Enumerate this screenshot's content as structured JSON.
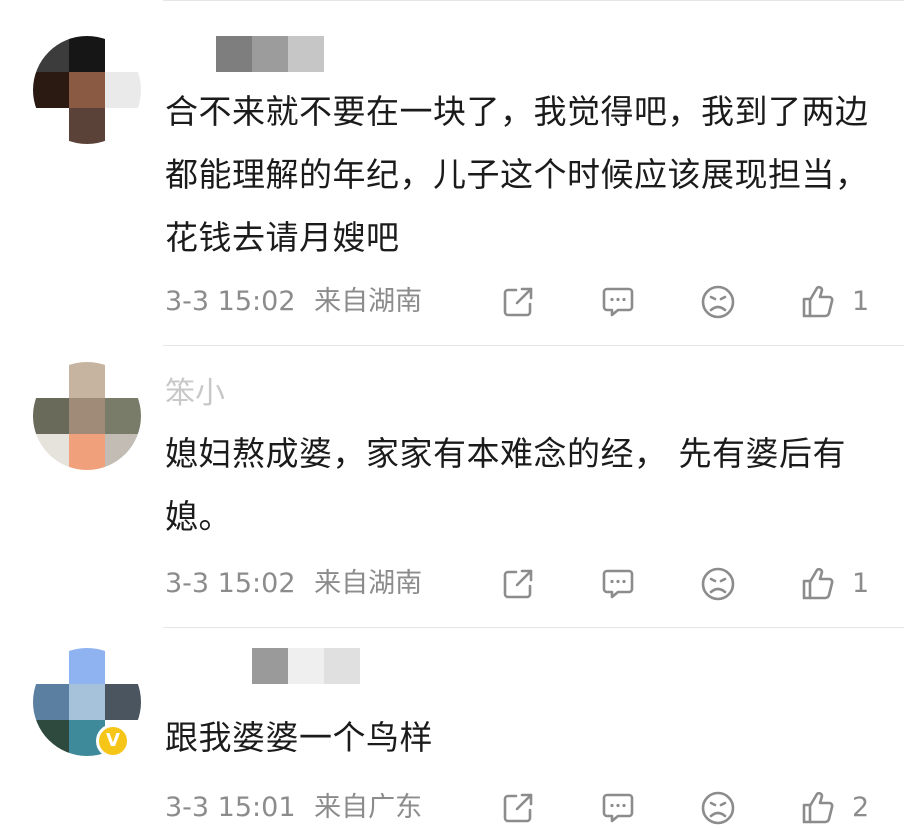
{
  "comments": [
    {
      "text": "合不来就不要在一块了，我觉得吧，我到了两边都能理解的年纪，儿子这个时候应该展现担当，花钱去请月嫂吧",
      "time": "3-3 15:02",
      "location": "来自湖南",
      "likes": "1",
      "verified": false
    },
    {
      "username_partial": "笨小",
      "text": "媳妇熬成婆，家家有本难念的经，  先有婆后有媳。",
      "time": "3-3 15:02",
      "location": "来自湖南",
      "likes": "1",
      "verified": false
    },
    {
      "text": "跟我婆婆一个鸟样",
      "time": "3-3 15:01",
      "location": "来自广东",
      "likes": "2",
      "verified": true,
      "badge_glyph": "V"
    }
  ],
  "icons": {
    "share": "share-icon",
    "comment": "comment-icon",
    "dislike": "sad-face-icon",
    "like": "thumbs-up-icon"
  },
  "colors": {
    "text": "#1b1b1b",
    "meta": "#8c8c8c",
    "badge": "#f5c518",
    "separator": "#e6e6e6"
  }
}
